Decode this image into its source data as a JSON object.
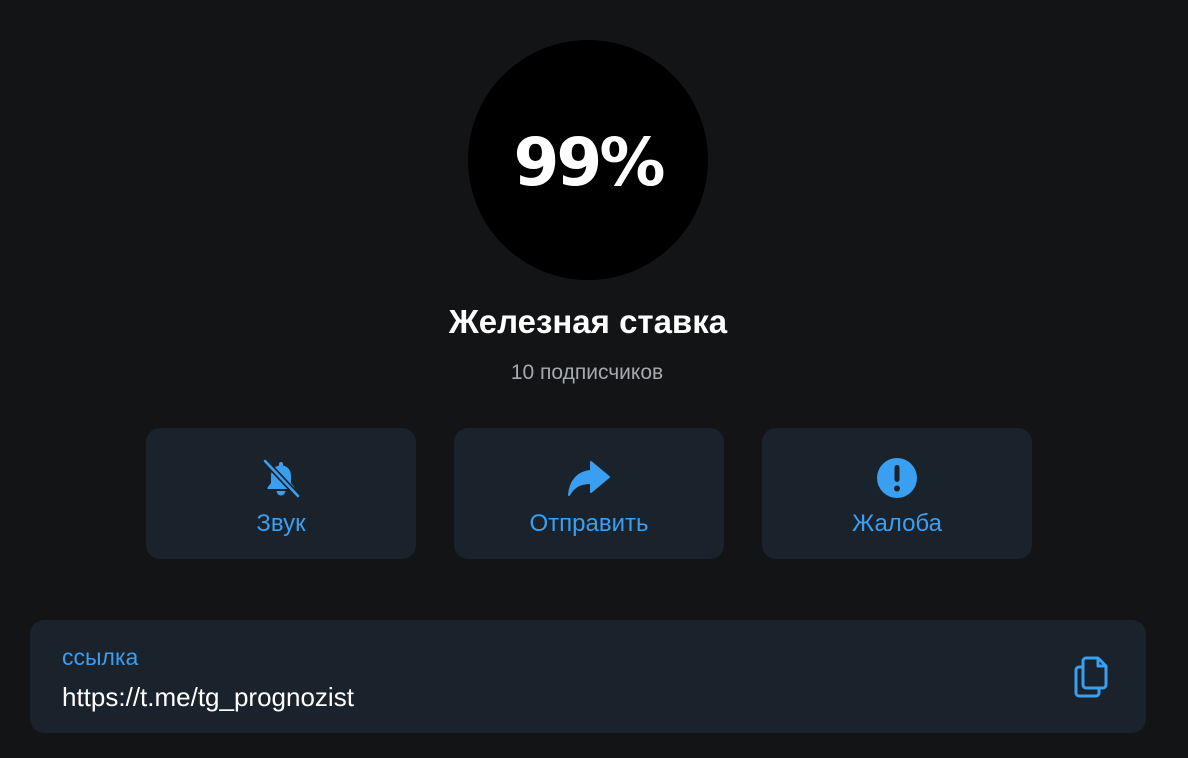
{
  "avatar": {
    "text": "99%"
  },
  "channel": {
    "name": "Железная ставка",
    "subscribers": "10 подписчиков"
  },
  "actions": [
    {
      "label": "Звук",
      "icon": "bell-muted-icon"
    },
    {
      "label": "Отправить",
      "icon": "share-arrow-icon"
    },
    {
      "label": "Жалоба",
      "icon": "exclamation-circle-icon"
    }
  ],
  "link": {
    "label": "ссылка",
    "value": "https://t.me/tg_prognozist",
    "copy_icon": "copy-icon"
  },
  "colors": {
    "background": "#131416",
    "card": "#1a222c",
    "accent": "#3a9ff0",
    "secondary_text": "#a6a9ad"
  }
}
